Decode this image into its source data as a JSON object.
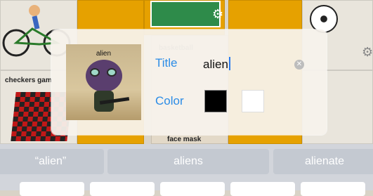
{
  "background_tiles": {
    "checkers_label": "checkers gam",
    "basketball_label": "basketball",
    "face_mask_label": "face mask"
  },
  "dialog": {
    "photo_caption": "alien",
    "title_label": "Title",
    "title_value": "alien",
    "color_label": "Color",
    "clear_icon": "clear-circle-icon",
    "colors": {
      "selected": "#000000",
      "alternate": "#ffffff"
    }
  },
  "keyboard": {
    "suggestions": [
      "“alien”",
      "aliens",
      "alienate"
    ]
  },
  "accent": "#2b8ce6"
}
